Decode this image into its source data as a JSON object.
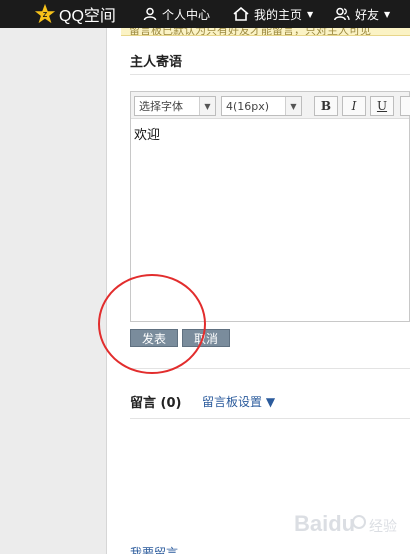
{
  "topbar": {
    "app_name": "QQ空间",
    "nav": [
      {
        "label": "个人中心"
      },
      {
        "label": "我的主页"
      },
      {
        "label": "好友"
      }
    ]
  },
  "notice": {
    "text": "留言板已默认为只有好友才能留言，只对主人可见"
  },
  "host_message": {
    "title": "主人寄语",
    "font_select": "选择字体",
    "size_select": "4(16px)",
    "bold": "B",
    "italic": "I",
    "underline": "U",
    "content": "欢迎"
  },
  "buttons": {
    "publish": "发表",
    "cancel": "取消"
  },
  "guestbook": {
    "title": "留言 (0)",
    "settings": "留言板设置 ▼"
  },
  "write_link": "我要留言",
  "watermark": {
    "brand": "Baidu",
    "sub": "经验"
  },
  "colors": {
    "topbar": "#1b1b1b",
    "button": "#7a8c9c",
    "annotation": "#e22d2d",
    "link": "#2b5b9c"
  }
}
